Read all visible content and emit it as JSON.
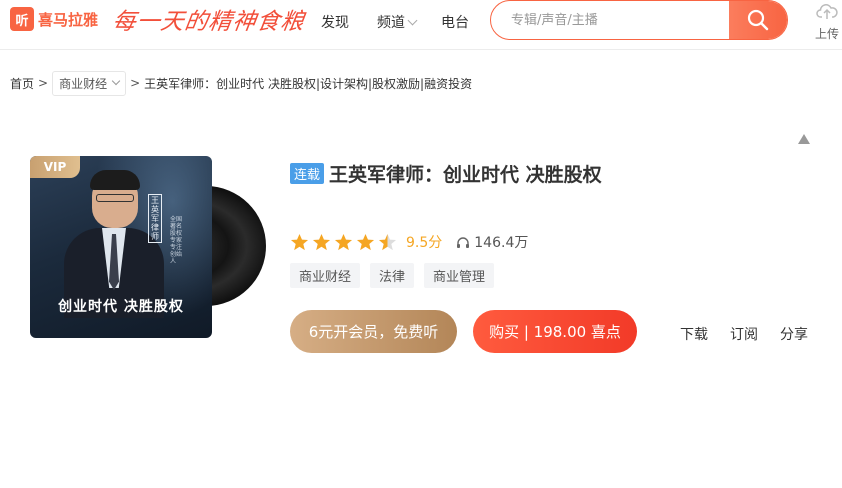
{
  "header": {
    "logo_mark": "听",
    "logo_text": "喜马拉雅",
    "slogan": "每一天的精神食粮",
    "nav": {
      "discover": "发现",
      "channel": "频道",
      "radio": "电台"
    },
    "search": {
      "placeholder": "专辑/声音/主播",
      "icon": "search-icon"
    },
    "upload_label": "上传",
    "accent_color": "#f86442"
  },
  "breadcrumb": {
    "home": "首页",
    "sep1": ">",
    "category": "商业财经",
    "sep2": ">",
    "current": "王英军律师：创业时代 决胜股权|设计架构|股权激励|融资投资"
  },
  "cover": {
    "vip_label": "VIP",
    "vertical_text": "王英军律师",
    "side_text": "全国著名股权专家 专注创始人",
    "title_text": "创业时代 决胜股权"
  },
  "album": {
    "badge": "连载",
    "title": "王英军律师：创业时代 决胜股权",
    "rating_stars": 4.5,
    "rating_max": 5,
    "score": "9.5分",
    "plays": "146.4万",
    "tags": [
      "商业财经",
      "法律",
      "商业管理"
    ]
  },
  "actions": {
    "member_button": "6元开会员，免费听",
    "buy_button": "购买 | 198.00 喜点",
    "download": "下载",
    "subscribe": "订阅",
    "share": "分享"
  }
}
